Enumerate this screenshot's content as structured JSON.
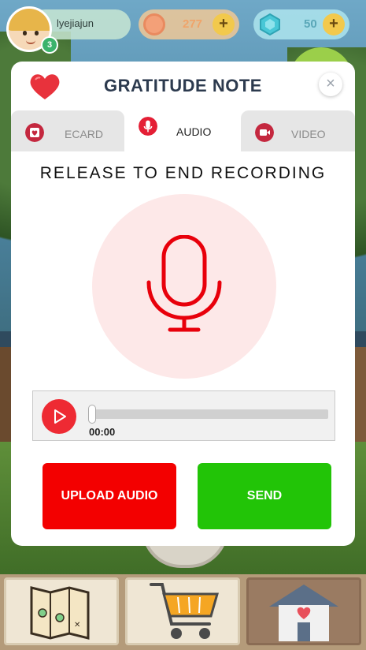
{
  "hud": {
    "player_name": "lyejiajun",
    "level": "3",
    "coins": "277",
    "gems": "50",
    "plus_symbol": "+"
  },
  "modal": {
    "title": "GRATITUDE NOTE",
    "close_symbol": "×",
    "tabs": [
      {
        "label": "ECARD",
        "icon": "ecard-icon",
        "active": false
      },
      {
        "label": "AUDIO",
        "icon": "microphone-icon",
        "active": true
      },
      {
        "label": "VIDEO",
        "icon": "video-icon",
        "active": false
      }
    ],
    "instruction": "RELEASE TO END RECORDING",
    "player": {
      "time": "00:00",
      "progress": 0
    },
    "buttons": {
      "upload": "UPLOAD AUDIO",
      "send": "SEND"
    }
  },
  "bottom_nav": {
    "items": [
      {
        "icon": "map-icon"
      },
      {
        "icon": "shopping-cart-icon"
      },
      {
        "icon": "home-icon"
      }
    ]
  },
  "colors": {
    "accent_red": "#f30000",
    "send_green": "#22c407",
    "mic_red": "#e8000b",
    "title_navy": "#2c3a4e"
  }
}
